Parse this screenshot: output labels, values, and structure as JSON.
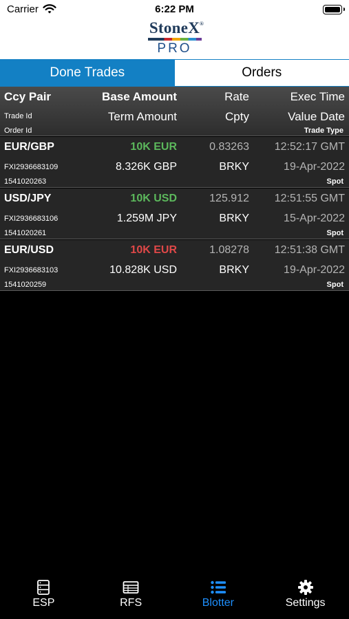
{
  "status_bar": {
    "carrier": "Carrier",
    "time": "6:22 PM"
  },
  "logo": {
    "brand": "StoneX",
    "sub": "PRO"
  },
  "tabs": [
    {
      "label": "Done Trades",
      "active": true
    },
    {
      "label": "Orders",
      "active": false
    }
  ],
  "header": {
    "ccy_pair": "Ccy Pair",
    "base_amount": "Base Amount",
    "rate": "Rate",
    "exec_time": "Exec Time",
    "trade_id": "Trade Id",
    "term_amount": "Term Amount",
    "cpty": "Cpty",
    "value_date": "Value Date",
    "order_id": "Order Id",
    "trade_type": "Trade Type"
  },
  "trades": [
    {
      "pair": "EUR/GBP",
      "base_amount": "10K EUR",
      "side_color": "#5cb85c",
      "rate": "0.83263",
      "exec_time": "12:52:17 GMT",
      "trade_id": "FXI2936683109",
      "term_amount": "8.326K GBP",
      "cpty": "BRKY",
      "value_date": "19-Apr-2022",
      "order_id": "1541020263",
      "trade_type": "Spot"
    },
    {
      "pair": "USD/JPY",
      "base_amount": "10K USD",
      "side_color": "#5cb85c",
      "rate": "125.912",
      "exec_time": "12:51:55 GMT",
      "trade_id": "FXI2936683106",
      "term_amount": "1.259M JPY",
      "cpty": "BRKY",
      "value_date": "15-Apr-2022",
      "order_id": "1541020261",
      "trade_type": "Spot"
    },
    {
      "pair": "EUR/USD",
      "base_amount": "10K EUR",
      "side_color": "#e04848",
      "rate": "1.08278",
      "exec_time": "12:51:38 GMT",
      "trade_id": "FXI2936683103",
      "term_amount": "10.828K USD",
      "cpty": "BRKY",
      "value_date": "19-Apr-2022",
      "order_id": "1541020259",
      "trade_type": "Spot"
    }
  ],
  "tabbar": [
    {
      "label": "ESP",
      "icon": "server-icon",
      "active": false
    },
    {
      "label": "RFS",
      "icon": "table-icon",
      "active": false
    },
    {
      "label": "Blotter",
      "icon": "list-icon",
      "active": true
    },
    {
      "label": "Settings",
      "icon": "gear-icon",
      "active": false
    }
  ],
  "colors": {
    "accent": "#1380c4",
    "buy": "#5cb85c",
    "sell": "#e04848",
    "tab_active": "#1e90ff"
  }
}
